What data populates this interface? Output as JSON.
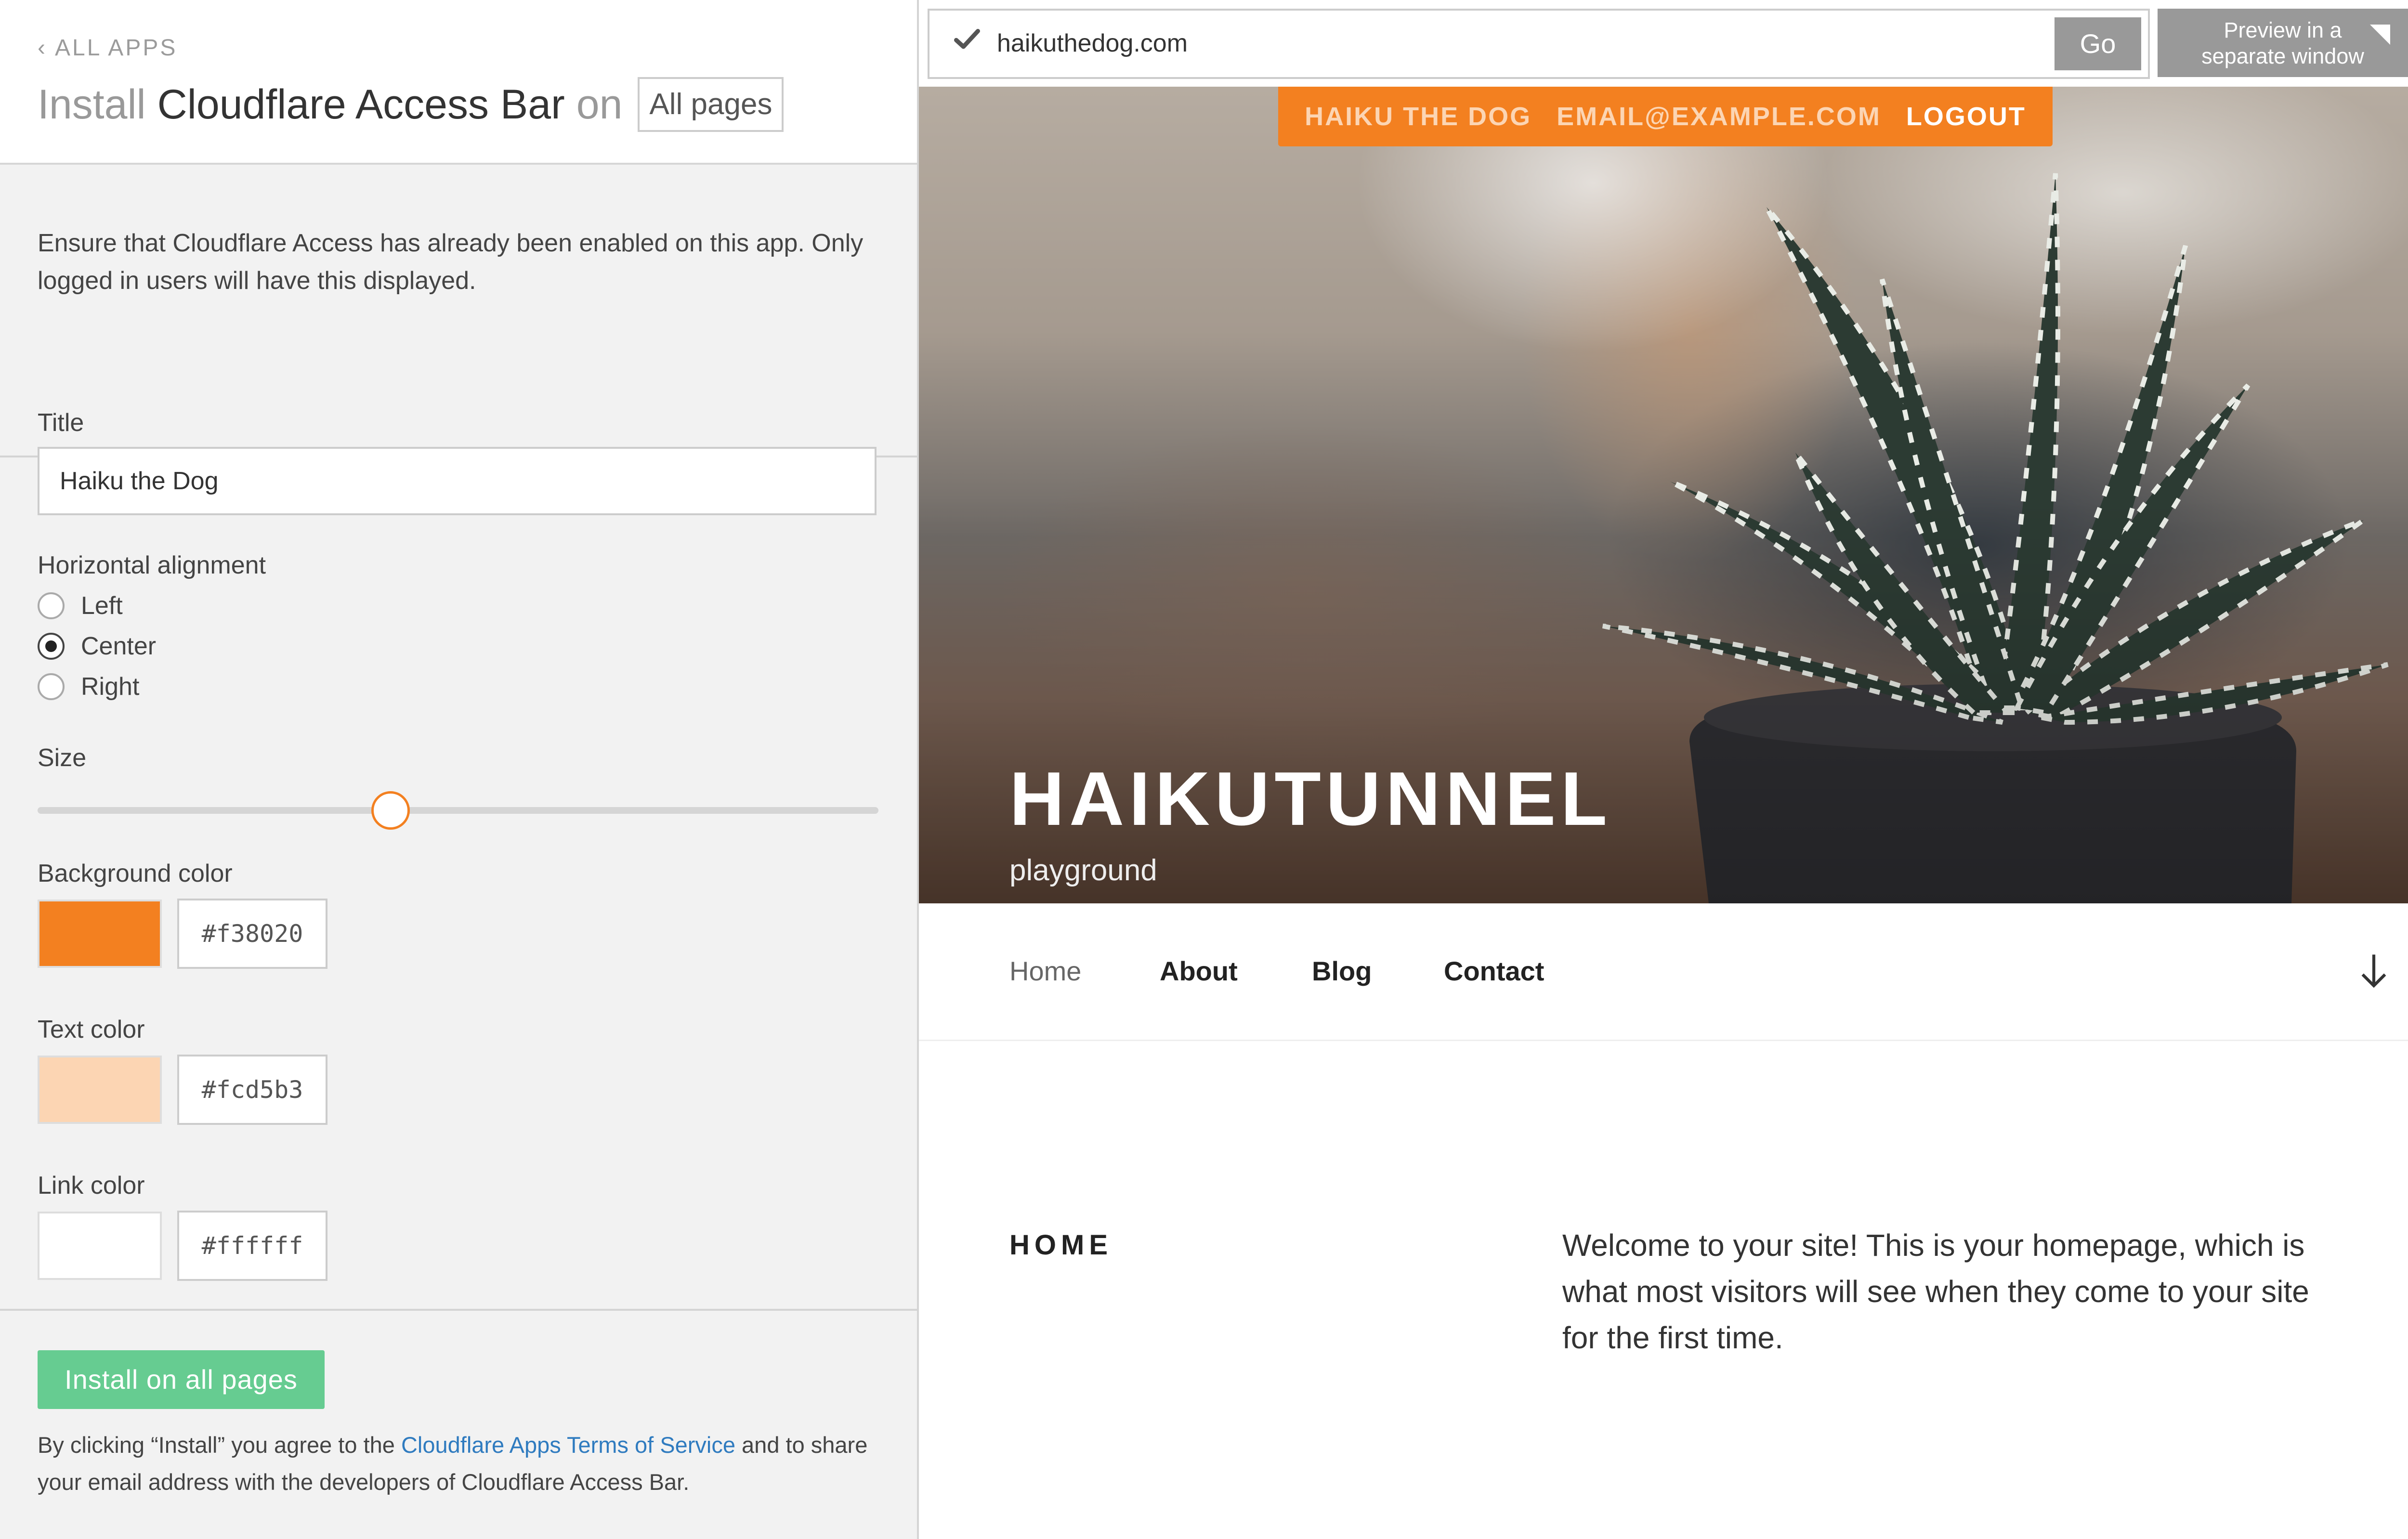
{
  "left_panel": {
    "back_link": "ALL APPS",
    "title": {
      "prefix": "Install",
      "app_name": "Cloudflare Access Bar",
      "connector": "on",
      "scope": "All pages"
    },
    "notice": "Ensure that Cloudflare Access has already been enabled on this app. Only logged in users will have this displayed.",
    "fields": {
      "title_label": "Title",
      "title_value": "Haiku the Dog",
      "alignment_label": "Horizontal alignment",
      "alignment_options": [
        "Left",
        "Center",
        "Right"
      ],
      "alignment_selected": "Center",
      "size_label": "Size",
      "size_value_fraction": 0.42,
      "background_color_label": "Background color",
      "background_color": "#f38020",
      "text_color_label": "Text color",
      "text_color": "#fcd5b3",
      "link_color_label": "Link color",
      "link_color": "#ffffff"
    },
    "install_button": "Install on all pages",
    "legal": {
      "before": "By clicking “Install” you agree to the ",
      "link": "Cloudflare Apps Terms of Service",
      "after": " and to share your email address with the developers of Cloudflare Access Bar."
    }
  },
  "preview": {
    "url": "haikuthedog.com",
    "go_label": "Go",
    "open_window_label": [
      "Preview in a",
      "separate window"
    ],
    "access_bar": {
      "name": "HAIKU THE DOG",
      "email": "EMAIL@EXAMPLE.COM",
      "logout": "LOGOUT"
    },
    "site": {
      "title": "HAIKUTUNNEL",
      "tagline": "playground",
      "nav": [
        "Home",
        "About",
        "Blog",
        "Contact"
      ],
      "nav_current": "Home",
      "section_heading": "HOME",
      "welcome_text": "Welcome to your site! This is your homepage, which is what most visitors will see when they come to your site for the first time."
    }
  },
  "icons": {
    "back": "chevron-left-icon",
    "url_status": "check-icon",
    "popout": "popout-icon",
    "scroll": "arrow-down-icon"
  }
}
